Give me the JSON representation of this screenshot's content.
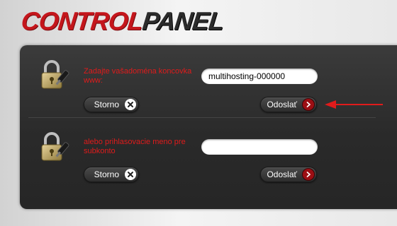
{
  "logo": {
    "part1": "CONTROL",
    "part2": "PANEL"
  },
  "rows": [
    {
      "prompt": "Zadajte vašadoména koncovka www:",
      "input_value": "multihosting-000000",
      "cancel_label": "Storno",
      "submit_label": "Odoslať"
    },
    {
      "prompt": "alebo prihlasovacie meno pre subkonto",
      "input_value": "",
      "cancel_label": "Storno",
      "submit_label": "Odoslať"
    }
  ],
  "icons": {
    "lock": "lock-key-icon",
    "cancel": "close-icon",
    "submit": "arrow-right-icon",
    "pointer": "red-arrow-icon"
  },
  "colors": {
    "brand_red": "#c4161c",
    "prompt_red": "#e01b1b",
    "panel_bg": "#2e2e2e"
  }
}
